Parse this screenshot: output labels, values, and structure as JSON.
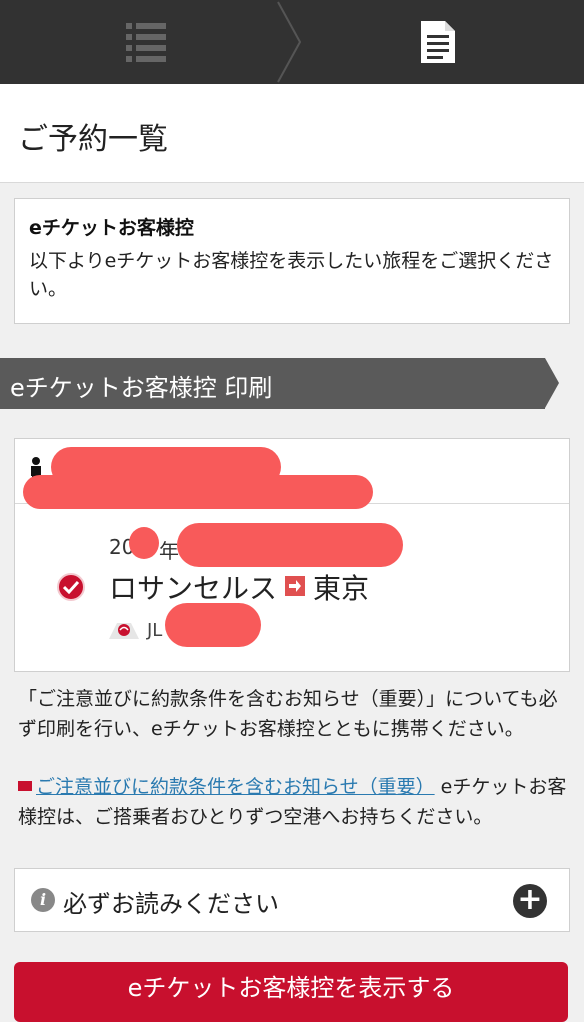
{
  "topbar": {
    "steps": [
      {
        "icon": "list-icon",
        "state": "done"
      },
      {
        "icon": "document-icon",
        "state": "active"
      }
    ]
  },
  "page": {
    "title": "ご予約一覧"
  },
  "info_card": {
    "heading": "eチケットお客様控",
    "text": "以下よりeチケットお客様控を表示したい旅程をご選択ください。"
  },
  "section": {
    "ribbon_label": "eチケットお客様控 印刷"
  },
  "booking": {
    "date_prefix": "20",
    "date_suffix": "年",
    "origin": "ロサンセルス",
    "destination": "東京",
    "airline_code": "JL",
    "selected": true
  },
  "notices": {
    "notice1": "「ご注意並びに約款条件を含むお知らせ（重要）」についても必ず印刷を行い、eチケットお客様控とともに携帯ください。",
    "notice2_link": "ご注意並びに約款条件を含むお知らせ（重要）",
    "notice2_text": " eチケットお客様控は、ご搭乗者おひとりずつ空港へお持ちください。"
  },
  "read_panel": {
    "label": "必ずお読みください"
  },
  "actions": {
    "show_button": "eチケットお客様控を表示する"
  },
  "colors": {
    "brand_red": "#c8102e",
    "dark_bar": "#323232",
    "ribbon": "#5a5a5a",
    "redaction": "#f85a5a",
    "link": "#2a7ab0"
  }
}
